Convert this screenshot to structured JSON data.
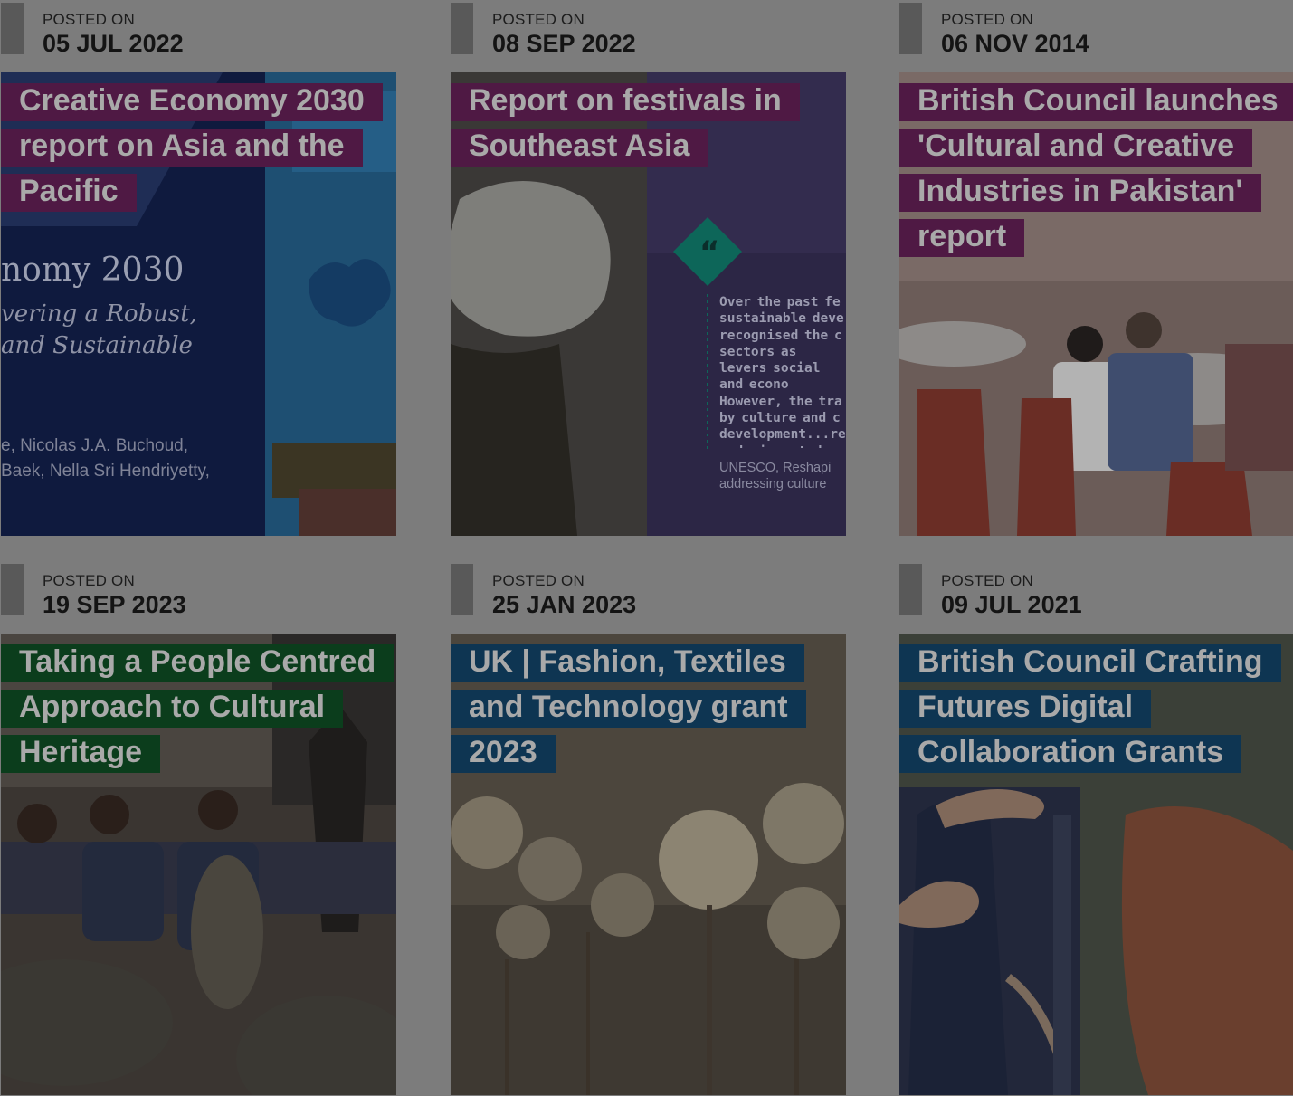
{
  "posted_label": "POSTED ON",
  "colors": {
    "overlay_gray": "#7c7c7c",
    "purple": "#4f1944",
    "green": "#0b3d1c",
    "blue": "#0e3552",
    "meta_bar": "#595959"
  },
  "cards": [
    {
      "date": "05 JUL 2022",
      "title": "Creative Economy 2030 report on Asia and the Pacific",
      "tag_color": "#4f1944",
      "image": "book-cover-image",
      "image_text": {
        "line1": "nomy 2030",
        "line2": "vering a Robust,",
        "line3": "and Sustainable",
        "line4": "e, Nicolas J.A. Buchoud,",
        "line5": "Baek, Nella Sri Hendriyetty,"
      }
    },
    {
      "date": "08 SEP 2022",
      "title": "Report on festivals in Southeast Asia",
      "tag_color": "#4f1944",
      "image": "festival-report-image",
      "image_text": {
        "quote": "Over the past fe sustainable deve recognised the c sectors as levers social and econo However, the tra by culture and c development...re underinvested",
        "source": "UNESCO, Reshapi addressing culture"
      }
    },
    {
      "date": "06 NOV 2014",
      "title": "British Council launches 'Cultural and Creative Industries in Pakistan' report",
      "tag_color": "#4f1944",
      "image": "conference-room-image"
    },
    {
      "date": "19 SEP 2023",
      "title": "Taking a People Centred Approach to Cultural Heritage",
      "tag_color": "#0b3d1c",
      "image": "gong-performers-image"
    },
    {
      "date": "25 JAN 2023",
      "title": "UK | Fashion, Textiles and Technology grant 2023",
      "tag_color": "#0e3552",
      "image": "fibre-bundles-image"
    },
    {
      "date": "09 JUL 2021",
      "title": "British Council Crafting Futures Digital Collaboration Grants",
      "tag_color": "#0e3552",
      "image": "textile-hands-image"
    }
  ]
}
